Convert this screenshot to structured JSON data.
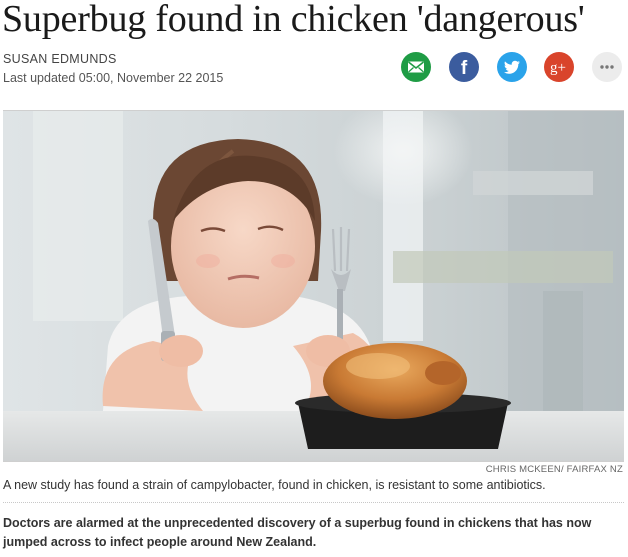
{
  "article": {
    "headline": "Superbug found in chicken 'dangerous'",
    "author": "SUSAN EDMUNDS",
    "updated": "Last updated 05:00, November 22 2015",
    "image_credit": "CHRIS MCKEEN/ FAIRFAX NZ",
    "caption": "A new study has found a strain of campylobacter, found in chicken, is resistant to some antibiotics.",
    "lede": "Doctors are alarmed at the unprecedented discovery of a superbug found in chickens that has now jumped across to infect people around New Zealand."
  },
  "share": {
    "icons": [
      "email-icon",
      "facebook-icon",
      "twitter-icon",
      "google-plus-icon",
      "more-icon"
    ],
    "colors": {
      "email": "#1f9c45",
      "facebook": "#3b5c9e",
      "twitter": "#2aa3ea",
      "google_plus": "#d9442b",
      "more": "#ececec"
    },
    "gplus_glyph": "g+",
    "facebook_glyph": "f"
  }
}
